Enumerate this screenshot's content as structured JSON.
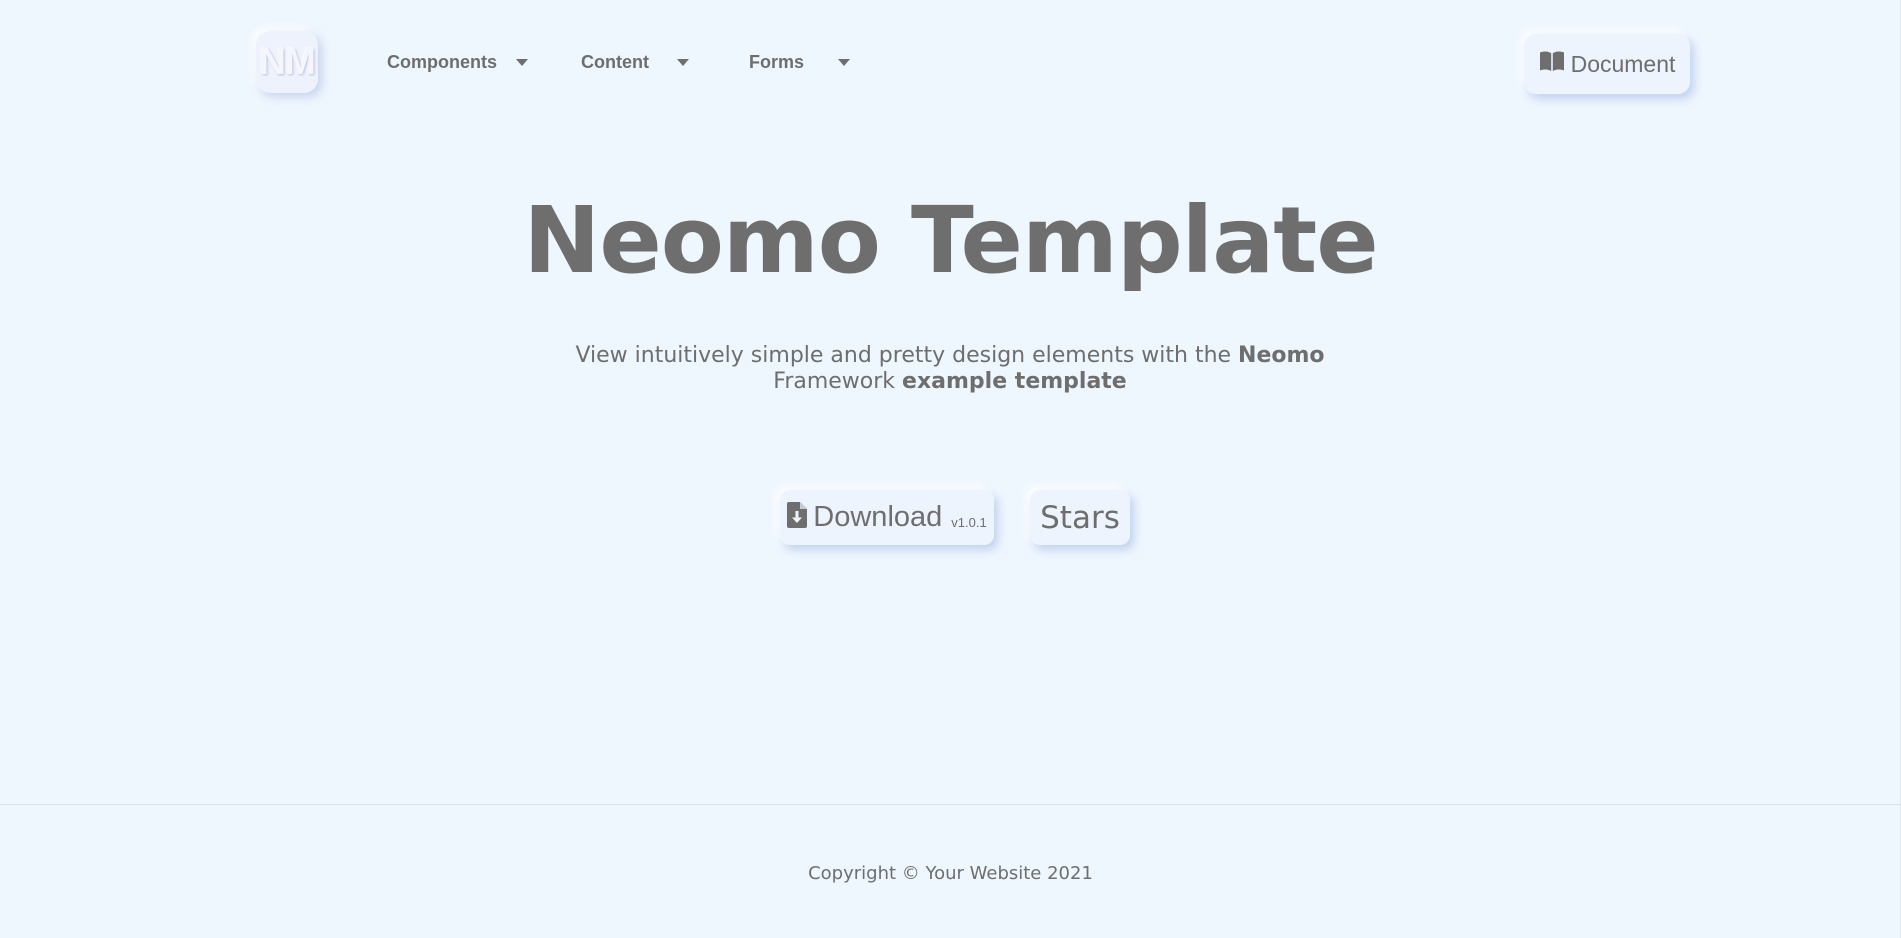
{
  "header": {
    "logo_text": "NM",
    "nav": [
      {
        "label": "Components",
        "icon": "caret-down-icon"
      },
      {
        "label": "Content",
        "icon": "caret-down-icon"
      },
      {
        "label": "Forms",
        "icon": "caret-down-icon"
      }
    ],
    "document_button": {
      "label": "Document",
      "icon": "book-icon"
    }
  },
  "hero": {
    "title": "Neomo Template",
    "subtitle_part1": "View intuitively simple and pretty design elements with the ",
    "subtitle_bold1": "Neomo",
    "subtitle_part2": "Framework ",
    "subtitle_bold2": "example template",
    "download_button": {
      "label": "Download",
      "version": "v1.0.1",
      "icon": "file-download-icon"
    },
    "stars_button": {
      "label": "Stars"
    }
  },
  "footer": {
    "copyright": "Copyright © Your Website 2021"
  },
  "colors": {
    "background": "#eef6fe",
    "text": "#6e6e6e"
  }
}
